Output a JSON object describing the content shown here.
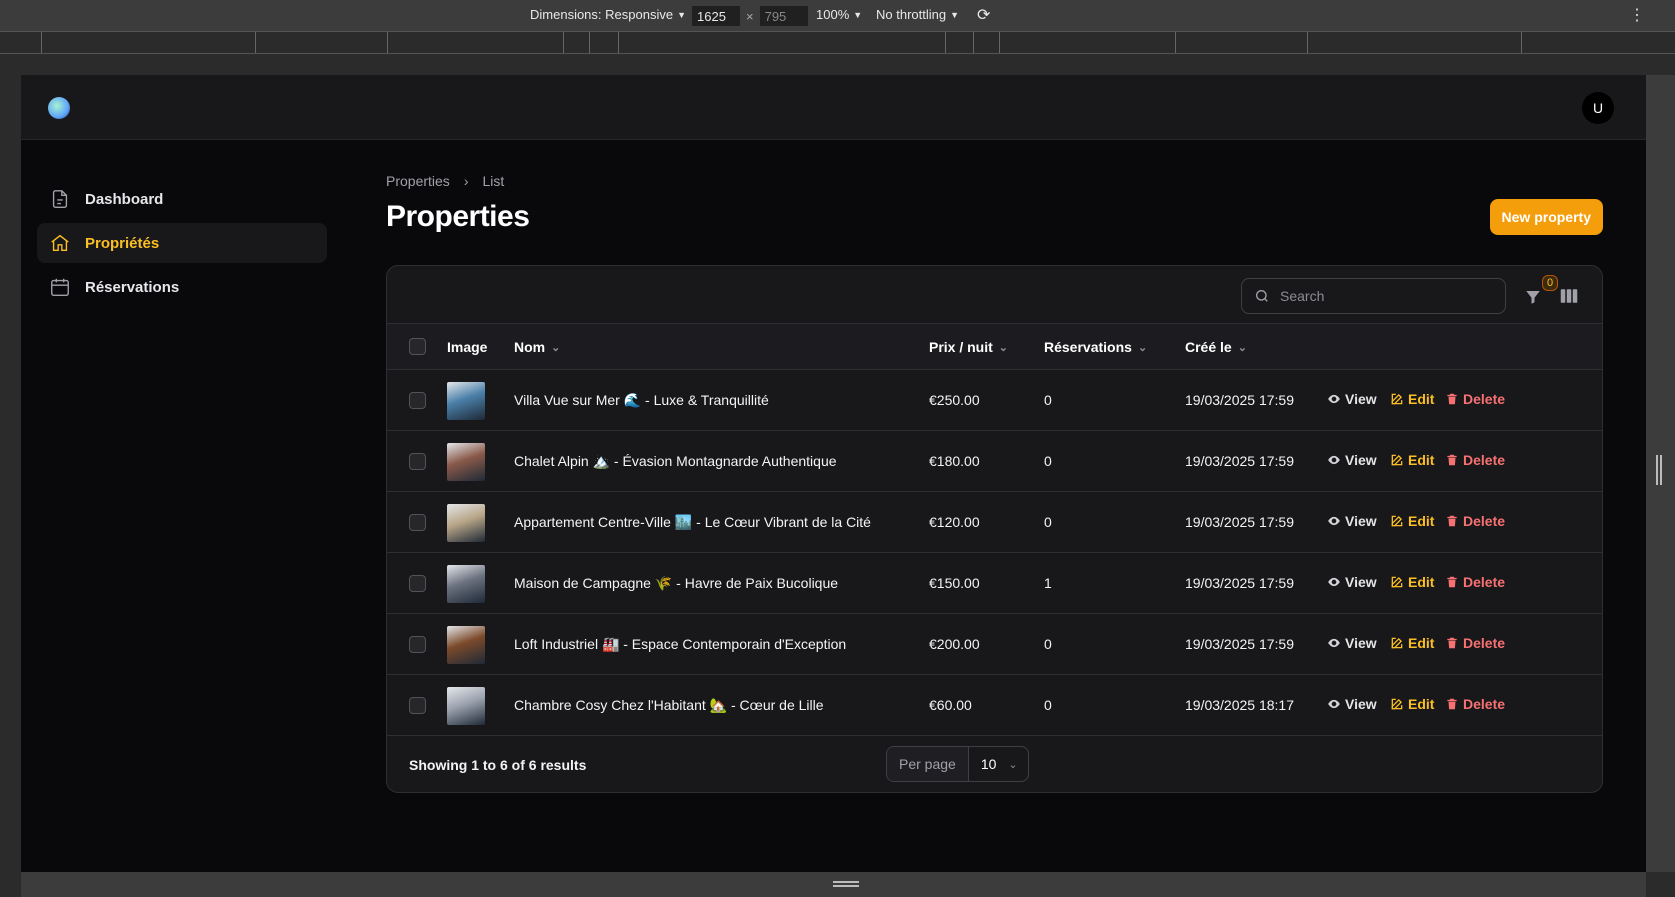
{
  "devtools": {
    "dimensions_label": "Dimensions: Responsive",
    "width": "1625",
    "height": "795",
    "zoom": "100%",
    "throttling": "No throttling"
  },
  "user": {
    "avatar_initial": "U"
  },
  "sidebar": {
    "items": [
      {
        "label": "Dashboard",
        "icon": "document-icon",
        "active": false
      },
      {
        "label": "Propriétés",
        "icon": "home-icon",
        "active": true
      },
      {
        "label": "Réservations",
        "icon": "calendar-icon",
        "active": false
      }
    ]
  },
  "breadcrumb": {
    "root": "Properties",
    "current": "List"
  },
  "page": {
    "title": "Properties",
    "new_button": "New property"
  },
  "search": {
    "placeholder": "Search"
  },
  "filters": {
    "count": "0"
  },
  "table": {
    "headers": {
      "image": "Image",
      "name": "Nom",
      "price": "Prix / nuit",
      "reservations": "Réservations",
      "created": "Créé le"
    },
    "actions": {
      "view": "View",
      "edit": "Edit",
      "delete": "Delete"
    },
    "rows": [
      {
        "name": "Villa Vue sur Mer 🌊 - Luxe & Tranquillité",
        "price": "€250.00",
        "reservations": "0",
        "created": "19/03/2025 17:59",
        "thumb_color": "#4a7fa8"
      },
      {
        "name": "Chalet Alpin 🏔️ - Évasion Montagnarde Authentique",
        "price": "€180.00",
        "reservations": "0",
        "created": "19/03/2025 17:59",
        "thumb_color": "#8a5a4a"
      },
      {
        "name": "Appartement Centre-Ville 🏙️ - Le Cœur Vibrant de la Cité",
        "price": "€120.00",
        "reservations": "0",
        "created": "19/03/2025 17:59",
        "thumb_color": "#b8a688"
      },
      {
        "name": "Maison de Campagne 🌾 - Havre de Paix Bucolique",
        "price": "€150.00",
        "reservations": "1",
        "created": "19/03/2025 17:59",
        "thumb_color": "#6b7280"
      },
      {
        "name": "Loft Industriel 🏭 - Espace Contemporain d'Exception",
        "price": "€200.00",
        "reservations": "0",
        "created": "19/03/2025 17:59",
        "thumb_color": "#7c4a2a"
      },
      {
        "name": "Chambre Cosy Chez l'Habitant 🏡 - Cœur de Lille",
        "price": "€60.00",
        "reservations": "0",
        "created": "19/03/2025 18:17",
        "thumb_color": "#9ca3af"
      }
    ]
  },
  "pagination": {
    "summary": "Showing 1 to 6 of 6 results",
    "per_page_label": "Per page",
    "per_page_value": "10"
  }
}
